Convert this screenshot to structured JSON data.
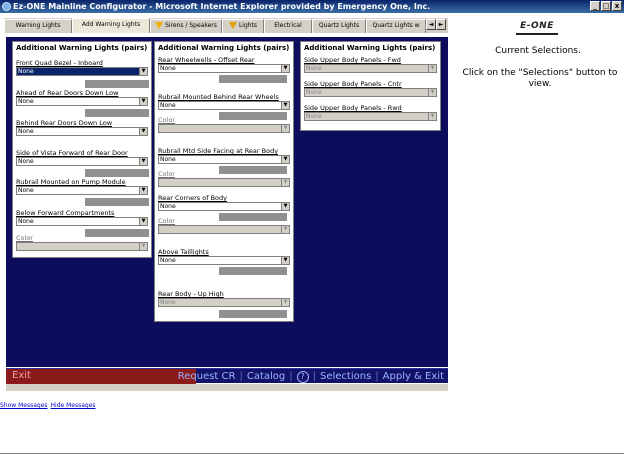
{
  "window": {
    "title": "Ez-ONE Mainline Configurator - Microsoft Internet Explorer provided by Emergency One, Inc.",
    "controls": [
      "_",
      "□",
      "x"
    ]
  },
  "tabs": [
    {
      "label": "Warning Lights",
      "icon": "",
      "active": false
    },
    {
      "label": "Add Warning Lights",
      "icon": "",
      "active": true
    },
    {
      "label": "Sirens / Speakers",
      "icon": "warning-icon",
      "active": false
    },
    {
      "label": "Lights",
      "icon": "warning-icon",
      "active": false
    },
    {
      "label": "Electrical",
      "icon": "",
      "active": false
    },
    {
      "label": "Quartz Lights",
      "icon": "",
      "active": false
    },
    {
      "label": "Quartz Lights w",
      "icon": "",
      "active": false
    }
  ],
  "tab_scroll": {
    "left": "◄",
    "right": "►"
  },
  "panel_left": {
    "title": "Additional Warning Lights (pairs)",
    "fields": [
      {
        "label": "Front Quad Bezel - Inboard",
        "value": "None",
        "state": "selected"
      },
      {
        "label": "Ahead of Rear Doors Down Low",
        "value": "None",
        "state": "normal"
      },
      {
        "label": "Behind Rear Doors Down Low",
        "value": "None",
        "state": "normal"
      },
      {
        "label": "Side of Vista Forward of Rear Door",
        "value": "None",
        "state": "normal"
      },
      {
        "label": "Rubrail Mounted on Pump Module",
        "value": "None",
        "state": "normal"
      },
      {
        "label": "Below Forward Compartments",
        "value": "None",
        "state": "normal"
      },
      {
        "label": "Color",
        "value": "",
        "state": "disabled"
      }
    ]
  },
  "panel_middle": {
    "title": "Additional Warning Lights (pairs)",
    "fields": [
      {
        "label": "Rear Wheelwells - Offset Rear",
        "value": "None",
        "state": "normal"
      },
      {
        "label": "Rubrail Mounted Behind Rear Wheels",
        "value": "None",
        "state": "normal"
      },
      {
        "label": "Color",
        "value": "",
        "state": "disabled"
      },
      {
        "label": "Rubrail Mtd Side Facing at Rear Body",
        "value": "None",
        "state": "normal"
      },
      {
        "label": "Color",
        "value": "",
        "state": "disabled"
      },
      {
        "label": "Rear Corners of Body",
        "value": "None",
        "state": "normal"
      },
      {
        "label": "Color",
        "value": "",
        "state": "disabled"
      },
      {
        "label": "Above Taillights",
        "value": "None",
        "state": "normal"
      },
      {
        "label": "Rear Body - Up High",
        "value": "None",
        "state": "disabled"
      }
    ]
  },
  "panel_right": {
    "title": "Additional Warning Lights (pairs)",
    "fields": [
      {
        "label": "Side Upper Body Panels - Fwd",
        "value": "None",
        "state": "disabled"
      },
      {
        "label": "Side Upper Body Panels - Cntr",
        "value": "None",
        "state": "disabled"
      },
      {
        "label": "Side Upper Body Panels - Rwd",
        "value": "None",
        "state": "disabled"
      }
    ]
  },
  "footer": {
    "exit": "Exit",
    "request_cr": "Request CR",
    "catalog": "Catalog",
    "help": "?",
    "selections": "Selections",
    "apply_exit": "Apply & Exit"
  },
  "messages": {
    "show": "Show Messages",
    "hide": "Hide Messages"
  },
  "sidebar": {
    "logo": "E-ONE",
    "title": "Current Selections.",
    "text": "Click on the \"Selections\" button to view."
  },
  "colors": {
    "main_bg": "#0d0d5e",
    "exit_bg": "#8b1a1a",
    "link": "#9bb4ff"
  }
}
